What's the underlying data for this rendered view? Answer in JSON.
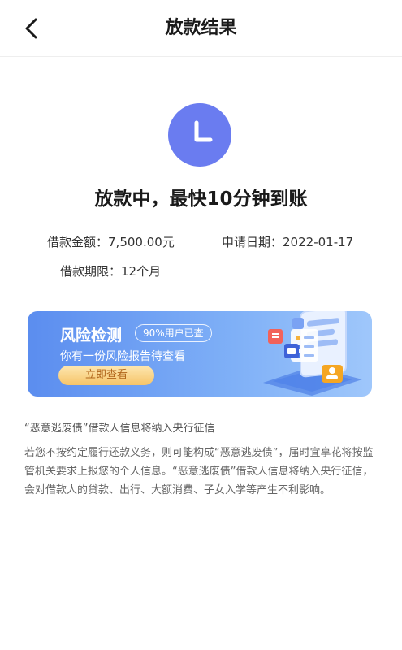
{
  "header": {
    "title": "放款结果",
    "back_icon": "chevron-left-icon"
  },
  "status": {
    "icon": "clock-icon",
    "icon_color": "#6a7cf0",
    "title": "放款中，最快10分钟到账"
  },
  "loan_info": {
    "amount_label": "借款金额：",
    "amount_value": "7,500.00元",
    "date_label": "申请日期：",
    "date_value": "2022-01-17",
    "term_label": "借款期限：",
    "term_value": "12个月"
  },
  "banner": {
    "title": "风险检测",
    "badge": "90%用户已查",
    "subtitle": "你有一份风险报告待查看",
    "button_label": "立即查看"
  },
  "notice": {
    "title": "“恶意逃废债”借款人信息将纳入央行征信",
    "body": "若您不按约定履行还款义务，则可能构成“恶意逃废债”，届时宜享花将按监管机关要求上报您的个人信息。“恶意逃废债”借款人信息将纳入央行征信，会对借款人的贷款、出行、大额消费、子女入学等产生不利影响。"
  }
}
